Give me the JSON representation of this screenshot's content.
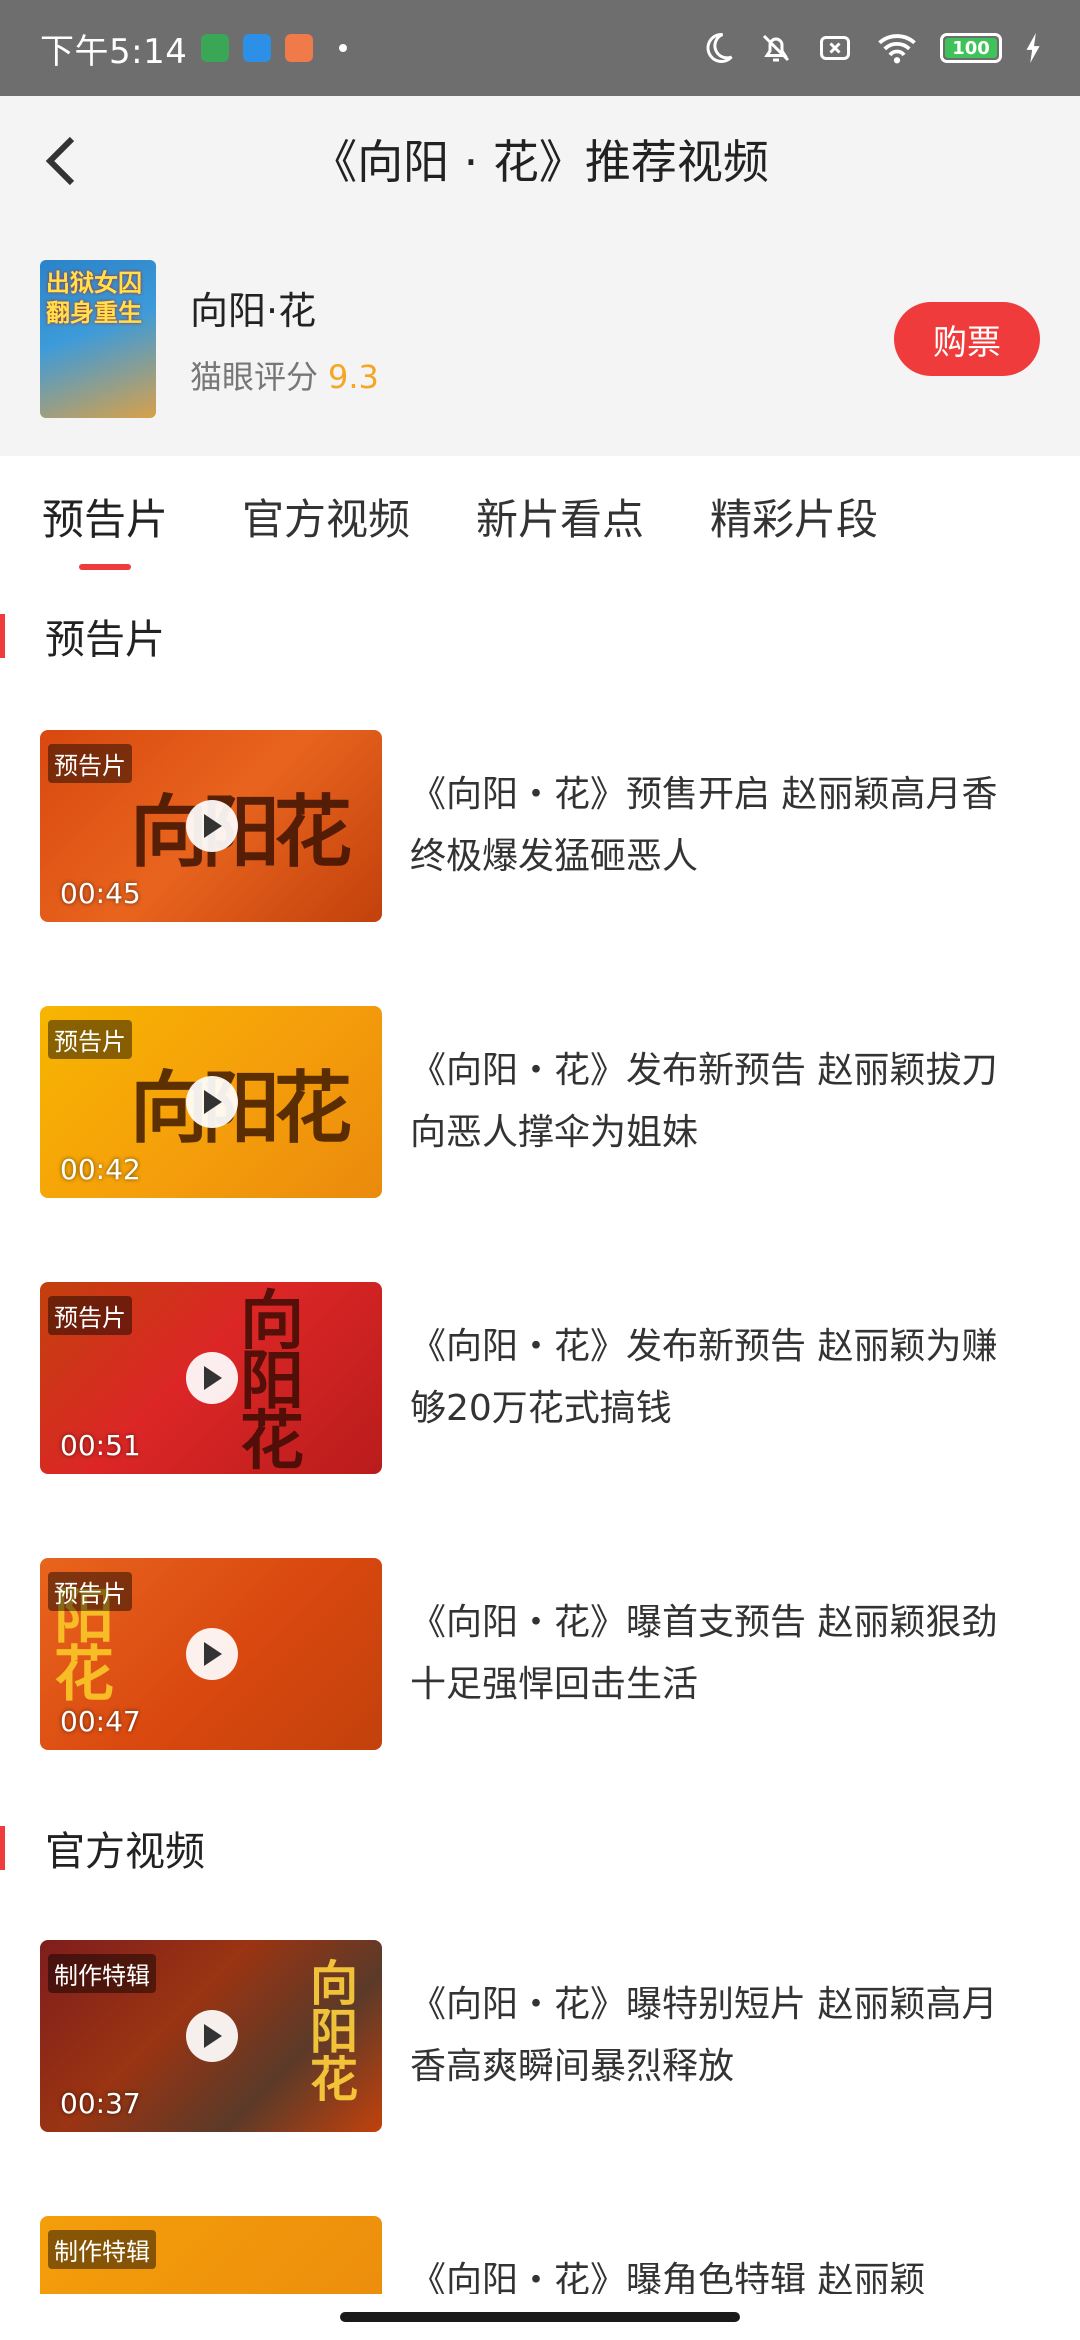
{
  "status_bar": {
    "time": "下午5:14",
    "battery": "100"
  },
  "header": {
    "title": "《向阳 · 花》推荐视频"
  },
  "movie": {
    "name": "向阳·花",
    "rating_label": "猫眼评分",
    "rating_value": "9.3",
    "buy_label": "购票",
    "poster_text": "出狱女囚翻身重生"
  },
  "tabs": [
    {
      "label": "预告片",
      "active": true
    },
    {
      "label": "官方视频",
      "active": false
    },
    {
      "label": "新片看点",
      "active": false
    },
    {
      "label": "精彩片段",
      "active": false
    }
  ],
  "sections": [
    {
      "title": "预告片",
      "videos": [
        {
          "tag": "预告片",
          "duration": "00:45",
          "title": "《向阳・花》预售开启 赵丽颖高月香终极爆发猛砸恶人"
        },
        {
          "tag": "预告片",
          "duration": "00:42",
          "title": "《向阳・花》发布新预告 赵丽颖拔刀向恶人撑伞为姐妹"
        },
        {
          "tag": "预告片",
          "duration": "00:51",
          "title": "《向阳・花》发布新预告 赵丽颖为赚够20万花式搞钱"
        },
        {
          "tag": "预告片",
          "duration": "00:47",
          "title": "《向阳・花》曝首支预告 赵丽颖狠劲十足强悍回击生活"
        }
      ]
    },
    {
      "title": "官方视频",
      "videos": [
        {
          "tag": "制作特辑",
          "duration": "00:37",
          "title": "《向阳・花》曝特别短片 赵丽颖高月香高爽瞬间暴烈释放"
        },
        {
          "tag": "制作特辑",
          "duration": "",
          "title": "《向阳・花》曝角色特辑 赵丽颖"
        }
      ]
    }
  ],
  "colors": {
    "accent": "#ef3b3b",
    "rating": "#f5a623"
  }
}
